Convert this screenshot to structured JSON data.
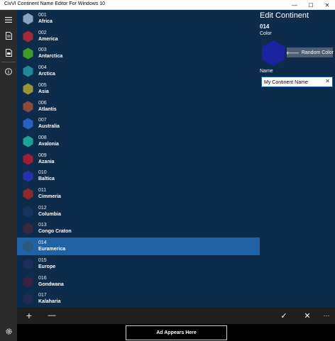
{
  "window": {
    "title": "CivVI Continent Name Editor For Windows 10",
    "controls": {
      "minimize": "—",
      "maximize": "☐",
      "close": "✕"
    }
  },
  "rail": {
    "icons": [
      "hamburger-menu-icon",
      "document-icon",
      "document-list-icon",
      "info-icon",
      "document-export-icon",
      "settings-gear-icon"
    ]
  },
  "continents": [
    {
      "code": "001",
      "name": "Africa",
      "color": "#8aa3bf"
    },
    {
      "code": "002",
      "name": "America",
      "color": "#a32a3a"
    },
    {
      "code": "003",
      "name": "Antarctica",
      "color": "#3f9a2c"
    },
    {
      "code": "004",
      "name": "Arctica",
      "color": "#1e8a99"
    },
    {
      "code": "005",
      "name": "Asia",
      "color": "#9a9538"
    },
    {
      "code": "006",
      "name": "Atlantis",
      "color": "#8f4a3c"
    },
    {
      "code": "007",
      "name": "Australia",
      "color": "#2a5fc4"
    },
    {
      "code": "008",
      "name": "Avalonia",
      "color": "#1aa39a"
    },
    {
      "code": "009",
      "name": "Azania",
      "color": "#a11f36"
    },
    {
      "code": "010",
      "name": "Baltica",
      "color": "#2a2fb0"
    },
    {
      "code": "011",
      "name": "Cimmeria",
      "color": "#8f2a2a"
    },
    {
      "code": "012",
      "name": "Columbia",
      "color": "#15355e"
    },
    {
      "code": "013",
      "name": "Congo Craton",
      "color": "#3a2a3e"
    },
    {
      "code": "014",
      "name": "Euramerica",
      "color": "#2a5a7a"
    },
    {
      "code": "015",
      "name": "Europe",
      "color": "#1c2e5e"
    },
    {
      "code": "016",
      "name": "Gondwana",
      "color": "#3a2240"
    },
    {
      "code": "017",
      "name": "Kalaharia",
      "color": "#222a55"
    }
  ],
  "selected_index": 13,
  "editor": {
    "heading": "Edit Continent",
    "code": "014",
    "color_label": "Color",
    "color": "#1a23a0",
    "random_button_label": "Random Color",
    "random_arrow": "🡐",
    "name_label": "Name",
    "name_value": "My Continent Name",
    "clear_glyph": "✕"
  },
  "commands": {
    "add": "+",
    "remove": "—",
    "accept": "✓",
    "cancel": "✕",
    "more": "···"
  },
  "ad": {
    "label": "Ad Appears Here"
  }
}
